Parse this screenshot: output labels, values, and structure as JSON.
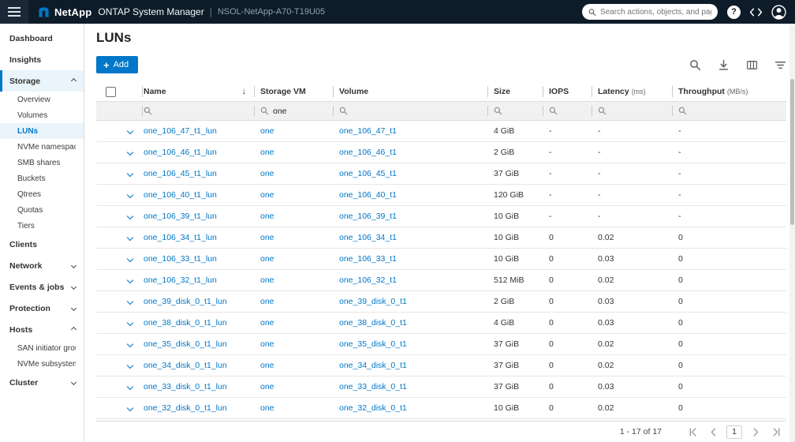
{
  "colors": {
    "accent": "#0077c8",
    "topbar_bg": "#0e1c2a",
    "link": "#0077c8",
    "selected_bg": "#e9f4fb"
  },
  "topbar": {
    "brand": "NetApp",
    "app_title": "ONTAP System Manager",
    "divider": "|",
    "system_name": "NSOL-NetApp-A70-T19U05",
    "search_placeholder": "Search actions, objects, and pages",
    "help_label": "?",
    "icons": [
      "menu-icon",
      "netapp-logo-icon",
      "search-icon",
      "help-icon",
      "code-icon",
      "avatar-icon"
    ]
  },
  "sidebar": {
    "items": [
      {
        "label": "Dashboard",
        "level": 1
      },
      {
        "label": "Insights",
        "level": 1
      },
      {
        "label": "Storage",
        "level": 1,
        "chevron": "up",
        "active_section": true
      },
      {
        "label": "Overview",
        "level": 2
      },
      {
        "label": "Volumes",
        "level": 2
      },
      {
        "label": "LUNs",
        "level": 2,
        "selected": true
      },
      {
        "label": "NVMe namespaces",
        "level": 2
      },
      {
        "label": "SMB shares",
        "level": 2
      },
      {
        "label": "Buckets",
        "level": 2
      },
      {
        "label": "Qtrees",
        "level": 2
      },
      {
        "label": "Quotas",
        "level": 2
      },
      {
        "label": "Tiers",
        "level": 2
      },
      {
        "label": "Clients",
        "level": 1
      },
      {
        "label": "Network",
        "level": 1,
        "chevron": "down"
      },
      {
        "label": "Events & jobs",
        "level": 1,
        "chevron": "down"
      },
      {
        "label": "Protection",
        "level": 1,
        "chevron": "down"
      },
      {
        "label": "Hosts",
        "level": 1,
        "chevron": "up"
      },
      {
        "label": "SAN initiator groups",
        "level": 2
      },
      {
        "label": "NVMe subsystem",
        "level": 2
      },
      {
        "label": "Cluster",
        "level": 1,
        "chevron": "down"
      }
    ]
  },
  "page": {
    "title": "LUNs"
  },
  "toolbar": {
    "add_label": "Add",
    "icons": [
      "search-icon",
      "download-icon",
      "columns-icon",
      "filter-icon"
    ]
  },
  "table": {
    "columns": [
      {
        "label": "Name"
      },
      {
        "label": "Storage VM"
      },
      {
        "label": "Volume"
      },
      {
        "label": "Size"
      },
      {
        "label": "IOPS"
      },
      {
        "label": "Latency",
        "unit": "(ms)"
      },
      {
        "label": "Throughput",
        "unit": "(MB/s)"
      }
    ],
    "filters": {
      "storage_vm": "one"
    },
    "rows": [
      {
        "name": "one_106_47_t1_lun",
        "storage_vm": "one",
        "volume": "one_106_47_t1",
        "size": "4 GiB",
        "iops": "-",
        "latency": "-",
        "throughput": "-"
      },
      {
        "name": "one_106_46_t1_lun",
        "storage_vm": "one",
        "volume": "one_106_46_t1",
        "size": "2 GiB",
        "iops": "-",
        "latency": "-",
        "throughput": "-"
      },
      {
        "name": "one_106_45_t1_lun",
        "storage_vm": "one",
        "volume": "one_106_45_t1",
        "size": "37 GiB",
        "iops": "-",
        "latency": "-",
        "throughput": "-"
      },
      {
        "name": "one_106_40_t1_lun",
        "storage_vm": "one",
        "volume": "one_106_40_t1",
        "size": "120 GiB",
        "iops": "-",
        "latency": "-",
        "throughput": "-"
      },
      {
        "name": "one_106_39_t1_lun",
        "storage_vm": "one",
        "volume": "one_106_39_t1",
        "size": "10 GiB",
        "iops": "-",
        "latency": "-",
        "throughput": "-"
      },
      {
        "name": "one_106_34_t1_lun",
        "storage_vm": "one",
        "volume": "one_106_34_t1",
        "size": "10 GiB",
        "iops": "0",
        "latency": "0.02",
        "throughput": "0"
      },
      {
        "name": "one_106_33_t1_lun",
        "storage_vm": "one",
        "volume": "one_106_33_t1",
        "size": "10 GiB",
        "iops": "0",
        "latency": "0.03",
        "throughput": "0"
      },
      {
        "name": "one_106_32_t1_lun",
        "storage_vm": "one",
        "volume": "one_106_32_t1",
        "size": "512 MiB",
        "iops": "0",
        "latency": "0.02",
        "throughput": "0"
      },
      {
        "name": "one_39_disk_0_t1_lun",
        "storage_vm": "one",
        "volume": "one_39_disk_0_t1",
        "size": "2 GiB",
        "iops": "0",
        "latency": "0.03",
        "throughput": "0"
      },
      {
        "name": "one_38_disk_0_t1_lun",
        "storage_vm": "one",
        "volume": "one_38_disk_0_t1",
        "size": "4 GiB",
        "iops": "0",
        "latency": "0.03",
        "throughput": "0"
      },
      {
        "name": "one_35_disk_0_t1_lun",
        "storage_vm": "one",
        "volume": "one_35_disk_0_t1",
        "size": "37 GiB",
        "iops": "0",
        "latency": "0.02",
        "throughput": "0"
      },
      {
        "name": "one_34_disk_0_t1_lun",
        "storage_vm": "one",
        "volume": "one_34_disk_0_t1",
        "size": "37 GiB",
        "iops": "0",
        "latency": "0.02",
        "throughput": "0"
      },
      {
        "name": "one_33_disk_0_t1_lun",
        "storage_vm": "one",
        "volume": "one_33_disk_0_t1",
        "size": "37 GiB",
        "iops": "0",
        "latency": "0.03",
        "throughput": "0"
      },
      {
        "name": "one_32_disk_0_t1_lun",
        "storage_vm": "one",
        "volume": "one_32_disk_0_t1",
        "size": "10 GiB",
        "iops": "0",
        "latency": "0.02",
        "throughput": "0"
      }
    ]
  },
  "pagination": {
    "summary": "1 - 17 of 17",
    "page": "1",
    "controls": [
      "first",
      "previous",
      "next",
      "last"
    ]
  }
}
